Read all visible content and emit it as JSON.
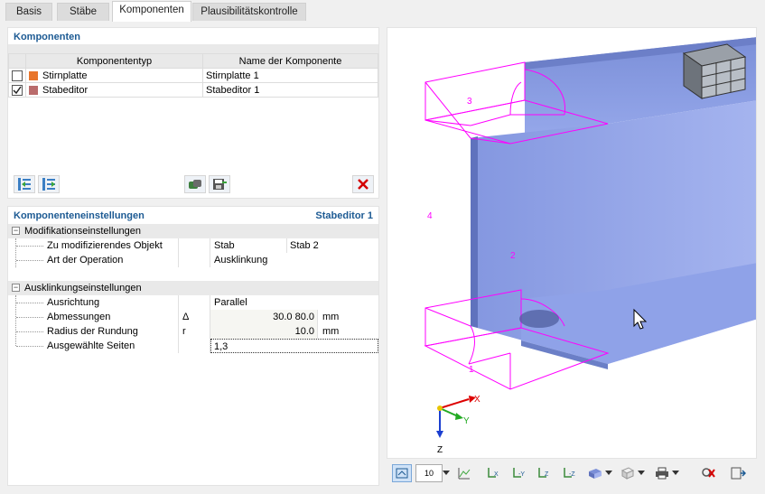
{
  "tabs": [
    "Basis",
    "Stäbe",
    "Komponenten",
    "Plausibilitätskontrolle"
  ],
  "components": {
    "title": "Komponenten",
    "columns": [
      "Komponententyp",
      "Name der Komponente"
    ],
    "rows": [
      {
        "checked": false,
        "color": "#e8752b",
        "type": "Stirnplatte",
        "name": "Stirnplatte 1"
      },
      {
        "checked": true,
        "color": "#b96b6b",
        "type": "Stabeditor",
        "name": "Stabeditor 1"
      }
    ]
  },
  "settings": {
    "title": "Komponenteneinstellungen",
    "selected": "Stabeditor 1",
    "modification": {
      "label": "Modifikationseinstellungen",
      "object_label": "Zu modifizierendes Objekt",
      "object_type": "Stab",
      "object_value": "Stab 2",
      "operation_label": "Art der Operation",
      "operation_value": "Ausklinkung"
    },
    "notch": {
      "label": "Ausklinkungseinstellungen",
      "orientation_label": "Ausrichtung",
      "orientation_value": "Parallel",
      "dims_label": "Abmessungen",
      "dims_symbol": "Δ",
      "dims_value": "30.0 80.0",
      "dims_unit": "mm",
      "radius_label": "Radius der Rundung",
      "radius_symbol": "r",
      "radius_value": "10.0",
      "radius_unit": "mm",
      "sides_label": "Ausgewählte Seiten",
      "sides_value": "1,3"
    }
  },
  "viewport": {
    "labels": {
      "n1": "1",
      "n2": "2",
      "n3": "3",
      "n4": "4"
    },
    "axes": {
      "x": "X",
      "y": "Y",
      "z": "Z"
    }
  },
  "toolbar": {
    "scale_value": "10"
  },
  "colors": {
    "accent": "#1c5a93",
    "beam": "#8ea3e8",
    "wire": "#ff00ff",
    "delete": "#d40000"
  }
}
